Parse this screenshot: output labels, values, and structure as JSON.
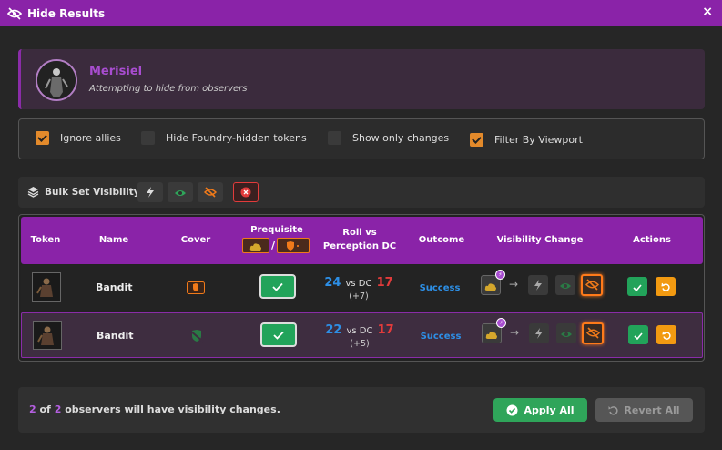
{
  "window": {
    "title": "Hide Results",
    "close_label": "×"
  },
  "header": {
    "name": "Merisiel",
    "subtitle": "Attempting to hide from observers"
  },
  "options": [
    {
      "label": "Ignore allies",
      "checked": true
    },
    {
      "label": "Hide Foundry-hidden tokens",
      "checked": false
    },
    {
      "label": "Show only changes",
      "checked": false
    },
    {
      "label": "Filter By Viewport",
      "checked": true
    }
  ],
  "bulk": {
    "label": "Bulk Set Visibility"
  },
  "table": {
    "headers": {
      "token": "Token",
      "name": "Name",
      "cover": "Cover",
      "prerequisite": "Prequisite",
      "roll_line1": "Roll vs",
      "roll_line2": "Perception DC",
      "outcome": "Outcome",
      "visibility": "Visibility Change",
      "actions": "Actions"
    },
    "rows": [
      {
        "name": "Bandit",
        "roll": "24",
        "vs": "vs DC",
        "dc": "17",
        "mod": "(+7)",
        "outcome": "Success"
      },
      {
        "name": "Bandit",
        "roll": "22",
        "vs": "vs DC",
        "dc": "17",
        "mod": "(+5)",
        "outcome": "Success"
      }
    ]
  },
  "footer": {
    "count": "2",
    "of": "of",
    "total": "2",
    "text": "observers will have visibility changes.",
    "apply_label": "Apply All",
    "revert_label": "Revert All"
  },
  "colors": {
    "accent": "#8a23a8",
    "success": "#2fa55a",
    "warning": "#f29a11",
    "roll": "#2d8fe6",
    "dc": "#e23b3b"
  }
}
